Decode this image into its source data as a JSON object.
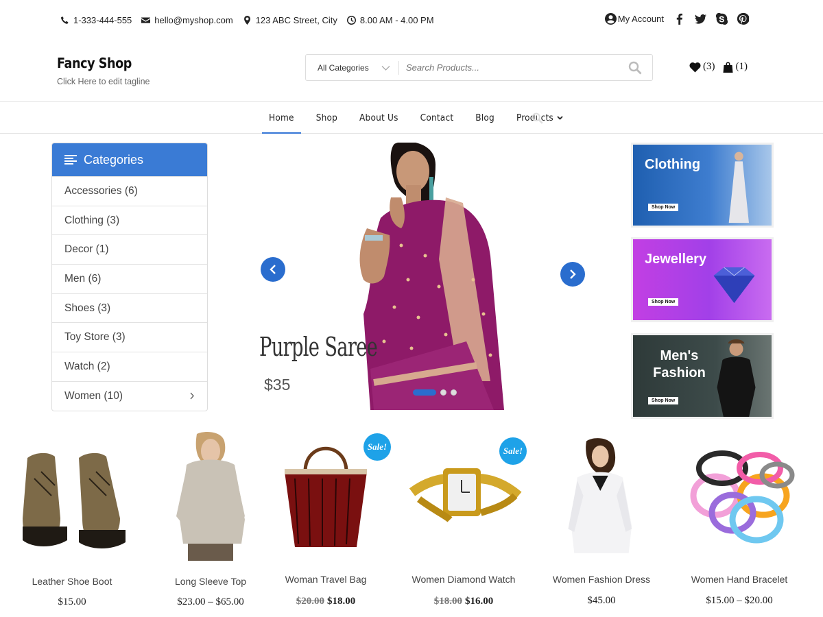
{
  "topbar": {
    "phone": "1-333-444-555",
    "email": "hello@myshop.com",
    "address": "123 ABC Street, City",
    "hours": "8.00 AM - 4.00 PM",
    "account_label": "My Account"
  },
  "header": {
    "logo": "Fancy Shop",
    "tagline": "Click Here to edit tagline",
    "search_category": "All Categories",
    "search_placeholder": "Search Products...",
    "wishlist_count": "(3)",
    "cart_count": "(1)"
  },
  "nav": {
    "items": [
      {
        "label": "Home"
      },
      {
        "label": "Shop"
      },
      {
        "label": "About Us"
      },
      {
        "label": "Contact"
      },
      {
        "label": "Blog"
      },
      {
        "label": "Products"
      }
    ]
  },
  "categories": {
    "title": "Categories",
    "items": [
      {
        "label": "Accessories (6)"
      },
      {
        "label": "Clothing (3)"
      },
      {
        "label": "Decor (1)"
      },
      {
        "label": "Men (6)"
      },
      {
        "label": "Shoes (3)"
      },
      {
        "label": "Toy Store (3)"
      },
      {
        "label": "Watch (2)"
      },
      {
        "label": "Women (10)"
      }
    ]
  },
  "slider": {
    "title": "Purple Saree",
    "price": "$35"
  },
  "banners": [
    {
      "title": "Clothing",
      "cta": "Shop Now"
    },
    {
      "title": "Jewellery",
      "cta": "Shop Now"
    },
    {
      "title": "Men's Fashion",
      "cta": "Shop Now"
    }
  ],
  "products": [
    {
      "name": "Leather Shoe Boot",
      "price": "$15.00"
    },
    {
      "name": "Long Sleeve Top",
      "price": "$23.00 – $65.00"
    },
    {
      "name": "Woman Travel Bag",
      "old_price": "$20.00",
      "price": "$18.00",
      "badge": "Sale!"
    },
    {
      "name": "Women Diamond Watch",
      "old_price": "$18.00",
      "price": "$16.00",
      "badge": "Sale!"
    },
    {
      "name": "Women Fashion Dress",
      "price": "$45.00"
    },
    {
      "name": "Women Hand Bracelet",
      "price": "$15.00 – $20.00"
    }
  ],
  "colors": {
    "accent": "#3a7bd5",
    "sale_badge": "#1ea2e8"
  }
}
